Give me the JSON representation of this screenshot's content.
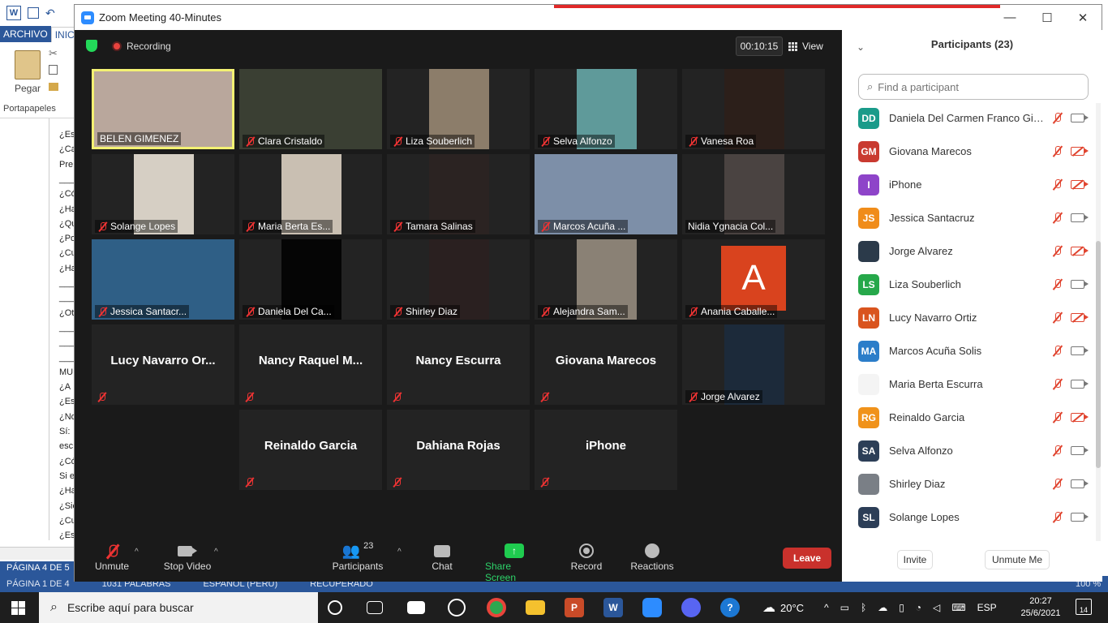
{
  "word": {
    "tab_archivo": "ARCHIVO",
    "tab_inicio": "INIC",
    "paste_label": "Pegar",
    "clipboard_group": "Portapapeles",
    "doc_lines": [
      "¿Es",
      "¿Ca",
      "Pre",
      "______",
      "¿Có",
      "¿Ha",
      "¿Qu",
      "¿Po",
      "¿Cu",
      "¿Ha",
      "______",
      "______",
      "¿Ot",
      "______",
      "______",
      "______",
      "MU",
      "¿A",
      "¿Es",
      "¿No",
      "Sí:",
      "esc",
      "¿Có",
      "Si e",
      "¿Ha",
      "¿Sie",
      "¿Cu",
      "¿Es"
    ],
    "status_page_top": "PÁGINA 4 DE 5",
    "status_page": "PÁGINA 1 DE 4",
    "status_words": "1031 PALABRAS",
    "status_lang": "ESPAÑOL (PERÚ)",
    "status_recovered": "RECUPERADO",
    "status_zoom": "100 %"
  },
  "zoom": {
    "window_title": "Zoom Meeting 40-Minutes",
    "recording_label": "Recording",
    "timer": "00:10:15",
    "view_label": "View",
    "tiles": [
      {
        "name": "BELEN GIMENEZ",
        "muted": false,
        "video": true,
        "active": true,
        "bg": "#b9a79c"
      },
      {
        "name": "Clara Cristaldo",
        "muted": true,
        "video": true,
        "bg": "#3a3f33"
      },
      {
        "name": "Liza Souberlich",
        "muted": true,
        "video": true,
        "bg": "#8c7d6a"
      },
      {
        "name": "Selva Alfonzo",
        "muted": true,
        "video": true,
        "bg": "#5f9a9a"
      },
      {
        "name": "Vanesa Roa",
        "muted": true,
        "video": true,
        "bg": "#2c1f1a"
      },
      {
        "name": "Solange Lopes",
        "muted": true,
        "video": true,
        "bg": "#d6cfc4"
      },
      {
        "name": "Maria Berta Es...",
        "muted": true,
        "video": true,
        "bg": "#c9bfb2"
      },
      {
        "name": "Tamara Salinas",
        "muted": true,
        "video": true,
        "bg": "#2b2322"
      },
      {
        "name": "Marcos Acuña ...",
        "muted": true,
        "video": true,
        "bg": "#7d8fa8"
      },
      {
        "name": "Nidia Ygnacia Col...",
        "muted": false,
        "video": true,
        "bg": "#4a4341"
      },
      {
        "name": "Jessica Santacr...",
        "muted": true,
        "video": true,
        "bg": "#2f5f86"
      },
      {
        "name": "Daniela Del Ca...",
        "muted": true,
        "video": true,
        "bg": "#050505"
      },
      {
        "name": "Shirley Diaz",
        "muted": true,
        "video": true,
        "bg": "#2a2020"
      },
      {
        "name": "Alejandra Sam...",
        "muted": true,
        "video": true,
        "bg": "#8a8175"
      },
      {
        "name": "Anania Caballe...",
        "muted": true,
        "video": false,
        "avatar": "A"
      },
      {
        "name": "Lucy  Navarro  Or...",
        "muted": true,
        "video": false
      },
      {
        "name": "Nancy  Raquel  M...",
        "muted": true,
        "video": false
      },
      {
        "name": "Nancy Escurra",
        "muted": true,
        "video": false
      },
      {
        "name": "Giovana Marecos",
        "muted": true,
        "video": false
      },
      {
        "name": "Jorge Alvarez",
        "muted": true,
        "video": true,
        "bg": "#1c2a3a"
      },
      {
        "name": "Reinaldo Garcia",
        "muted": true,
        "video": false
      },
      {
        "name": "Dahiana Rojas",
        "muted": true,
        "video": false
      },
      {
        "name": "iPhone",
        "muted": true,
        "video": false
      }
    ],
    "toolbar": {
      "unmute": "Unmute",
      "stop_video": "Stop Video",
      "participants": "Participants",
      "participants_count": "23",
      "chat": "Chat",
      "share_screen": "Share Screen",
      "record": "Record",
      "reactions": "Reactions",
      "leave": "Leave"
    },
    "panel": {
      "title": "Participants (23)",
      "search_placeholder": "Find a participant",
      "invite": "Invite",
      "unmute_me": "Unmute Me",
      "participants": [
        {
          "initials": "DD",
          "color": "#1a9b8a",
          "name": "Daniela Del Carmen Franco Gim...",
          "cam_off": false
        },
        {
          "initials": "GM",
          "color": "#c93a30",
          "name": "Giovana Marecos",
          "cam_off": true
        },
        {
          "initials": "I",
          "color": "#8e44c9",
          "name": "iPhone",
          "cam_off": true
        },
        {
          "initials": "JS",
          "color": "#f08c1a",
          "name": "Jessica Santacruz",
          "cam_off": false
        },
        {
          "initials": "",
          "color": "#2b3a4a",
          "name": "Jorge Alvarez",
          "cam_off": true
        },
        {
          "initials": "LS",
          "color": "#26a84a",
          "name": "Liza Souberlich",
          "cam_off": false
        },
        {
          "initials": "LN",
          "color": "#d9541e",
          "name": "Lucy Navarro Ortiz",
          "cam_off": true
        },
        {
          "initials": "MA",
          "color": "#2b7dc9",
          "name": "Marcos Acuña Solis",
          "cam_off": false
        },
        {
          "initials": "",
          "color": "#f4f4f4",
          "name": "Maria Berta Escurra",
          "cam_off": false
        },
        {
          "initials": "RG",
          "color": "#f0921a",
          "name": "Reinaldo Garcia",
          "cam_off": true
        },
        {
          "initials": "SA",
          "color": "#2c3e57",
          "name": "Selva Alfonzo",
          "cam_off": false
        },
        {
          "initials": "",
          "color": "#7a7f86",
          "name": "Shirley Diaz",
          "cam_off": false
        },
        {
          "initials": "SL",
          "color": "#2c3e57",
          "name": "Solange Lopes",
          "cam_off": false
        }
      ]
    }
  },
  "taskbar": {
    "search_placeholder": "Escribe aquí para buscar",
    "temperature": "20°C",
    "lang": "ESP",
    "time": "20:27",
    "date": "25/6/2021",
    "notifications": "14"
  }
}
